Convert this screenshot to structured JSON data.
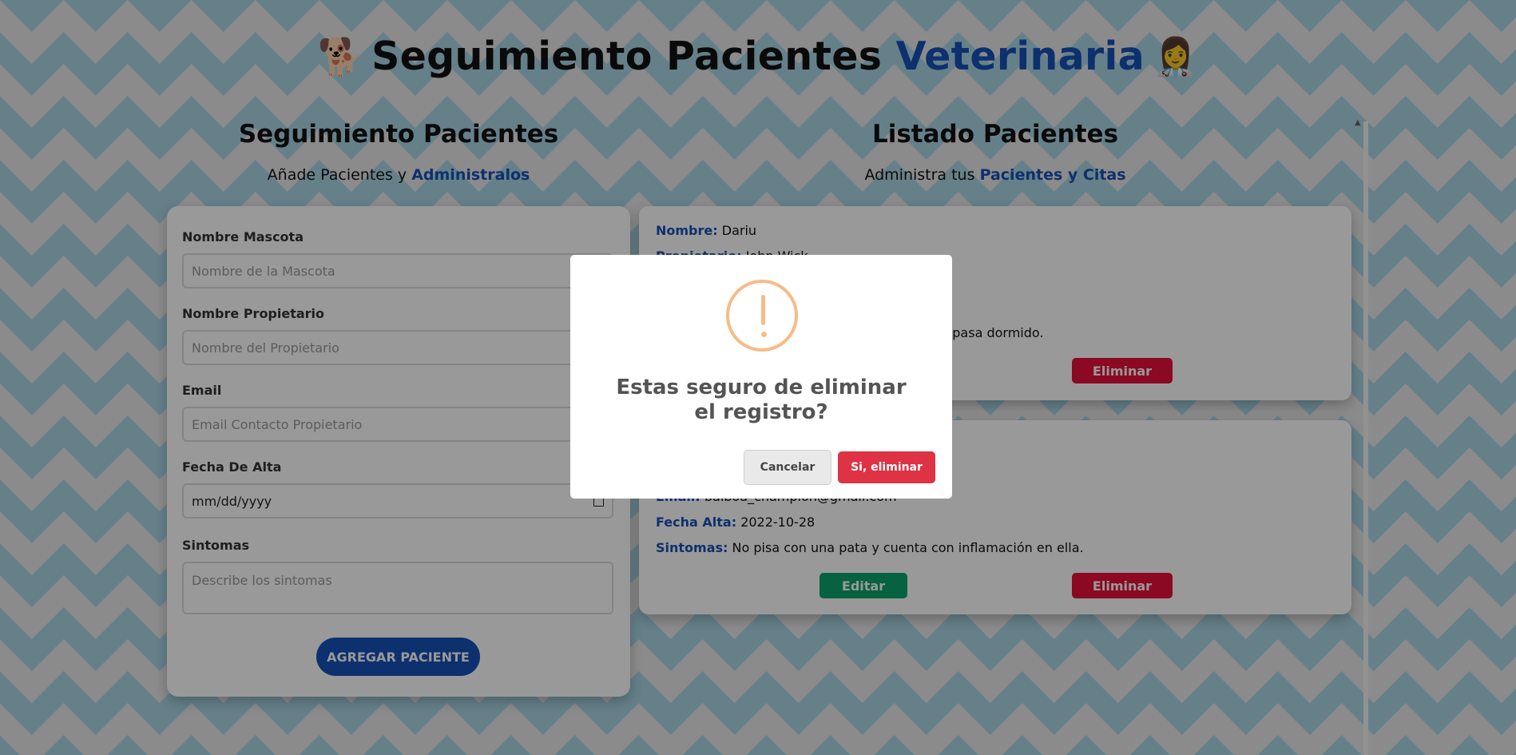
{
  "header": {
    "left_emoji": "🐕",
    "title_main": "Seguimiento Pacientes",
    "title_accent": "Veterinaria",
    "right_emoji": "👩‍⚕️"
  },
  "form_section": {
    "title": "Seguimiento Pacientes",
    "subtitle_prefix": "Añade Pacientes y",
    "subtitle_accent": "Administralos"
  },
  "list_section": {
    "title": "Listado Pacientes",
    "subtitle_prefix": "Administra tus",
    "subtitle_accent": "Pacientes y Citas"
  },
  "form": {
    "pet_label": "Nombre Mascota",
    "pet_placeholder": "Nombre de la Mascota",
    "owner_label": "Nombre Propietario",
    "owner_placeholder": "Nombre del Propietario",
    "email_label": "Email",
    "email_placeholder": "Email Contacto Propietario",
    "date_label": "Fecha De Alta",
    "date_value": "mm/dd/yyyy",
    "symptoms_label": "Sintomas",
    "symptoms_placeholder": "Describe los sintomas",
    "submit_label": "AGREGAR PACIENTE"
  },
  "patients": [
    {
      "name_key": "Nombre:",
      "name": "Dariu",
      "owner_key": "Propietario:",
      "owner": "John Wick",
      "symptoms_tail": "e la pasa dormido.",
      "delete_label": "Eliminar"
    },
    {
      "email_key": "Email:",
      "email": "balboa_champion@gmail.com",
      "date_key": "Fecha Alta:",
      "date": "2022-10-28",
      "symptoms_key": "Sintomas:",
      "symptoms": "No pisa con una pata y cuenta con inflamación en ella.",
      "edit_label": "Editar",
      "delete_label": "Eliminar"
    }
  ],
  "modal": {
    "icon": "warning-icon",
    "title": "Estas seguro de eliminar el registro?",
    "cancel_label": "Cancelar",
    "confirm_label": "Si, eliminar"
  },
  "colors": {
    "accent": "#1651b8",
    "edit": "#0aa36b",
    "delete": "#e8103a",
    "modal_confirm": "#dd3344",
    "warning": "#f8bb86"
  }
}
